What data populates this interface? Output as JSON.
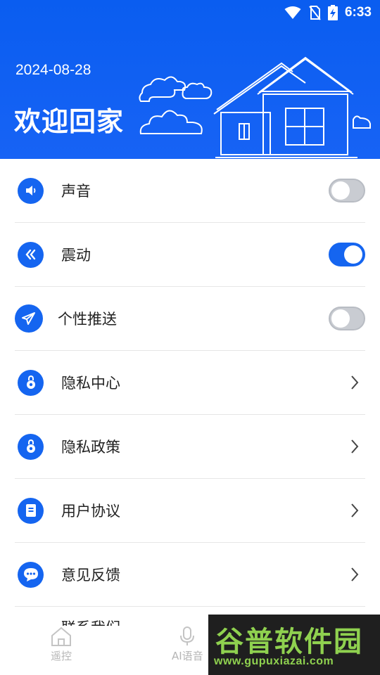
{
  "status_bar": {
    "time": "6:33",
    "icons": [
      "wifi-icon",
      "no-sim-icon",
      "battery-charging-icon"
    ]
  },
  "header": {
    "date": "2024-08-28",
    "title": "欢迎回家",
    "background_color": "#0a5df0"
  },
  "settings": {
    "sound": {
      "label": "声音",
      "icon": "speaker-icon",
      "enabled": false
    },
    "vibration": {
      "label": "震动",
      "icon": "vibration-icon",
      "enabled": true
    },
    "push": {
      "label": "个性推送",
      "icon": "paper-plane-icon",
      "enabled": false
    },
    "privacy_center": {
      "label": "隐私中心",
      "icon": "lock-icon"
    },
    "privacy_policy": {
      "label": "隐私政策",
      "icon": "lock-icon"
    },
    "user_agreement": {
      "label": "用户协议",
      "icon": "document-icon"
    },
    "feedback": {
      "label": "意见反馈",
      "icon": "chat-bubble-icon"
    },
    "contact_us": {
      "label": "联系我们"
    }
  },
  "bottom_nav": {
    "remote": {
      "label": "遥控",
      "icon": "home-icon"
    },
    "ai_voice": {
      "label": "AI语音",
      "icon": "microphone-icon"
    }
  },
  "watermark": {
    "title": "谷普软件园",
    "url": "www.gupuxiazai.com"
  },
  "colors": {
    "accent": "#1565f0",
    "toggle_off": "#c9ccd2",
    "divider": "#e6e6e6",
    "watermark_green": "#8fd14f"
  }
}
